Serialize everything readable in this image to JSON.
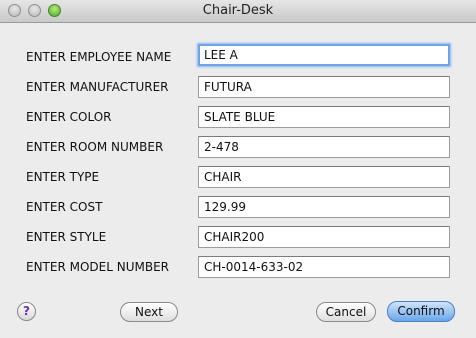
{
  "window": {
    "title": "Chair-Desk"
  },
  "fields": [
    {
      "label": "ENTER EMPLOYEE NAME",
      "value": "LEE A"
    },
    {
      "label": "ENTER MANUFACTURER",
      "value": "FUTURA"
    },
    {
      "label": "ENTER COLOR",
      "value": "SLATE BLUE"
    },
    {
      "label": "ENTER ROOM NUMBER",
      "value": "2-478"
    },
    {
      "label": "ENTER TYPE",
      "value": "CHAIR"
    },
    {
      "label": "ENTER COST",
      "value": "129.99"
    },
    {
      "label": "ENTER STYLE",
      "value": "CHAIR200"
    },
    {
      "label": "ENTER MODEL NUMBER",
      "value": "CH-0014-633-02"
    }
  ],
  "buttons": {
    "help": "?",
    "next": "Next",
    "cancel": "Cancel",
    "confirm": "Confirm"
  }
}
